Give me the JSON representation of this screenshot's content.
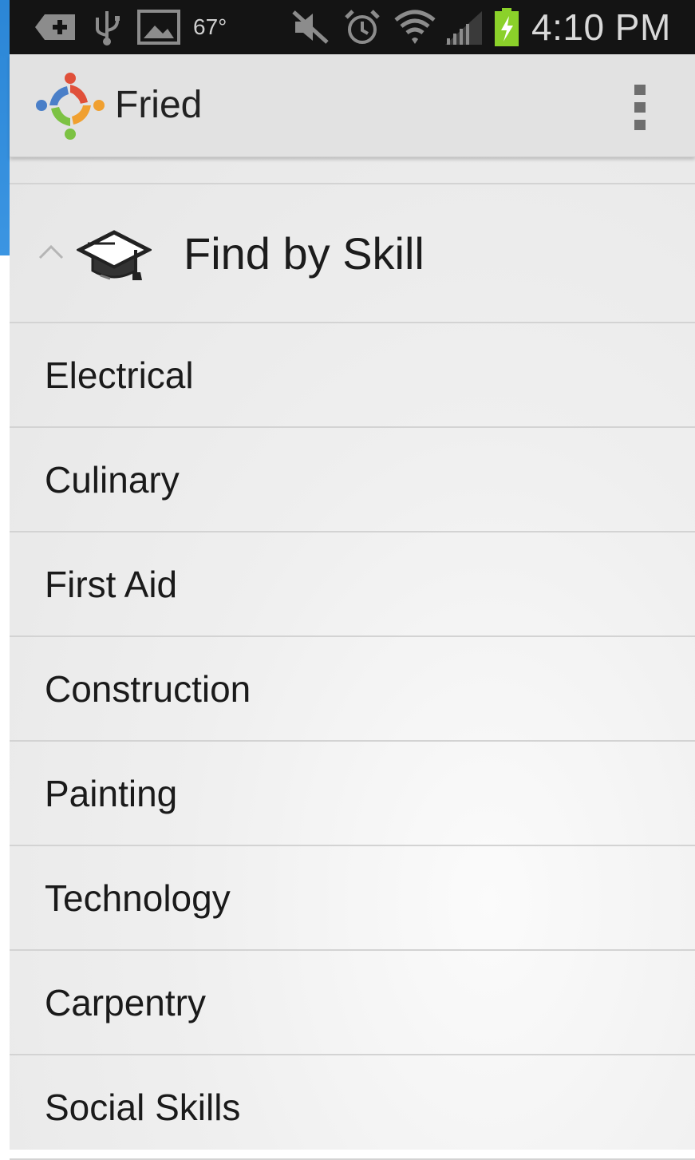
{
  "status_bar": {
    "temperature": "67°",
    "time": "4:10 PM",
    "icons": [
      "add-notification-icon",
      "usb-icon",
      "image-icon",
      "mute-icon",
      "alarm-icon",
      "wifi-icon",
      "signal-icon",
      "battery-charging-icon"
    ]
  },
  "action_bar": {
    "title": "Fried",
    "logo_icon": "fried-logo-icon",
    "overflow_icon": "overflow-menu-icon"
  },
  "drawer": {
    "group": {
      "title": "Find by Skill",
      "expanded_icon": "chevron-up-icon",
      "icon": "graduation-cap-icon"
    },
    "skills": [
      {
        "label": "Electrical"
      },
      {
        "label": "Culinary"
      },
      {
        "label": "First Aid"
      },
      {
        "label": "Construction"
      },
      {
        "label": "Painting"
      },
      {
        "label": "Technology"
      },
      {
        "label": "Carpentry"
      },
      {
        "label": "Social Skills"
      }
    ]
  },
  "colors": {
    "status_bar_bg": "#141414",
    "action_bar_bg": "#e2e2e2",
    "left_strip": "#2b86d6",
    "battery": "#8bd12a",
    "logo_red": "#e0503a",
    "logo_orange": "#f0a030",
    "logo_green": "#7cc243",
    "logo_blue": "#4a7fc8"
  }
}
